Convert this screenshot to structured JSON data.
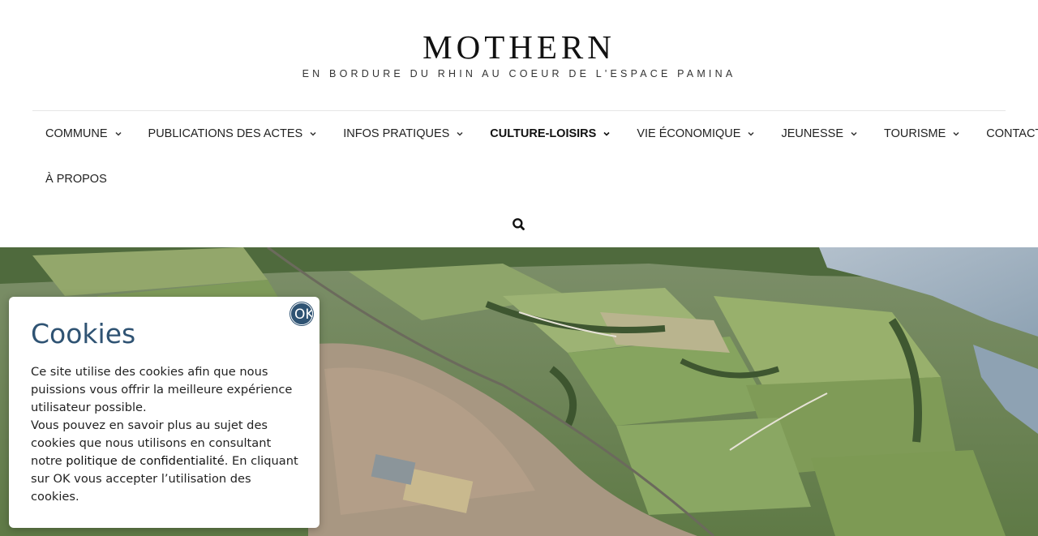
{
  "site": {
    "title": "MOTHERN",
    "tagline": "EN BORDURE DU RHIN AU COEUR DE L'ESPACE PAMINA"
  },
  "nav": {
    "items": [
      {
        "label": "COMMUNE",
        "has_dropdown": true
      },
      {
        "label": "PUBLICATIONS DES ACTES",
        "has_dropdown": true
      },
      {
        "label": "INFOS PRATIQUES",
        "has_dropdown": true
      },
      {
        "label": "CULTURE-LOISIRS",
        "has_dropdown": true,
        "active": true
      },
      {
        "label": "VIE ÉCONOMIQUE",
        "has_dropdown": true
      },
      {
        "label": "JEUNESSE",
        "has_dropdown": true
      },
      {
        "label": "TOURISME",
        "has_dropdown": true
      },
      {
        "label": "CONTACT",
        "has_dropdown": false
      },
      {
        "label": "À PROPOS",
        "has_dropdown": false
      }
    ],
    "search_icon": "search-icon"
  },
  "hero": {
    "image": "aerial-view-village-rhine"
  },
  "cookies": {
    "title": "Cookies",
    "text_1": "Ce site utilise des cookies afin que nous puissions vous offrir la meilleure expérience utilisateur possible.",
    "text_2_before": "Vous pouvez en savoir plus au sujet des cookies que nous utilisons en consultant notre ",
    "link_label": "politique de confidentialité",
    "text_2_after": ". En cliquant sur OK vous accepter l’utilisation des cookies.",
    "ok_label": "OK"
  },
  "colors": {
    "cookie_title": "#2f5373",
    "ok_button": "#2f5373"
  }
}
